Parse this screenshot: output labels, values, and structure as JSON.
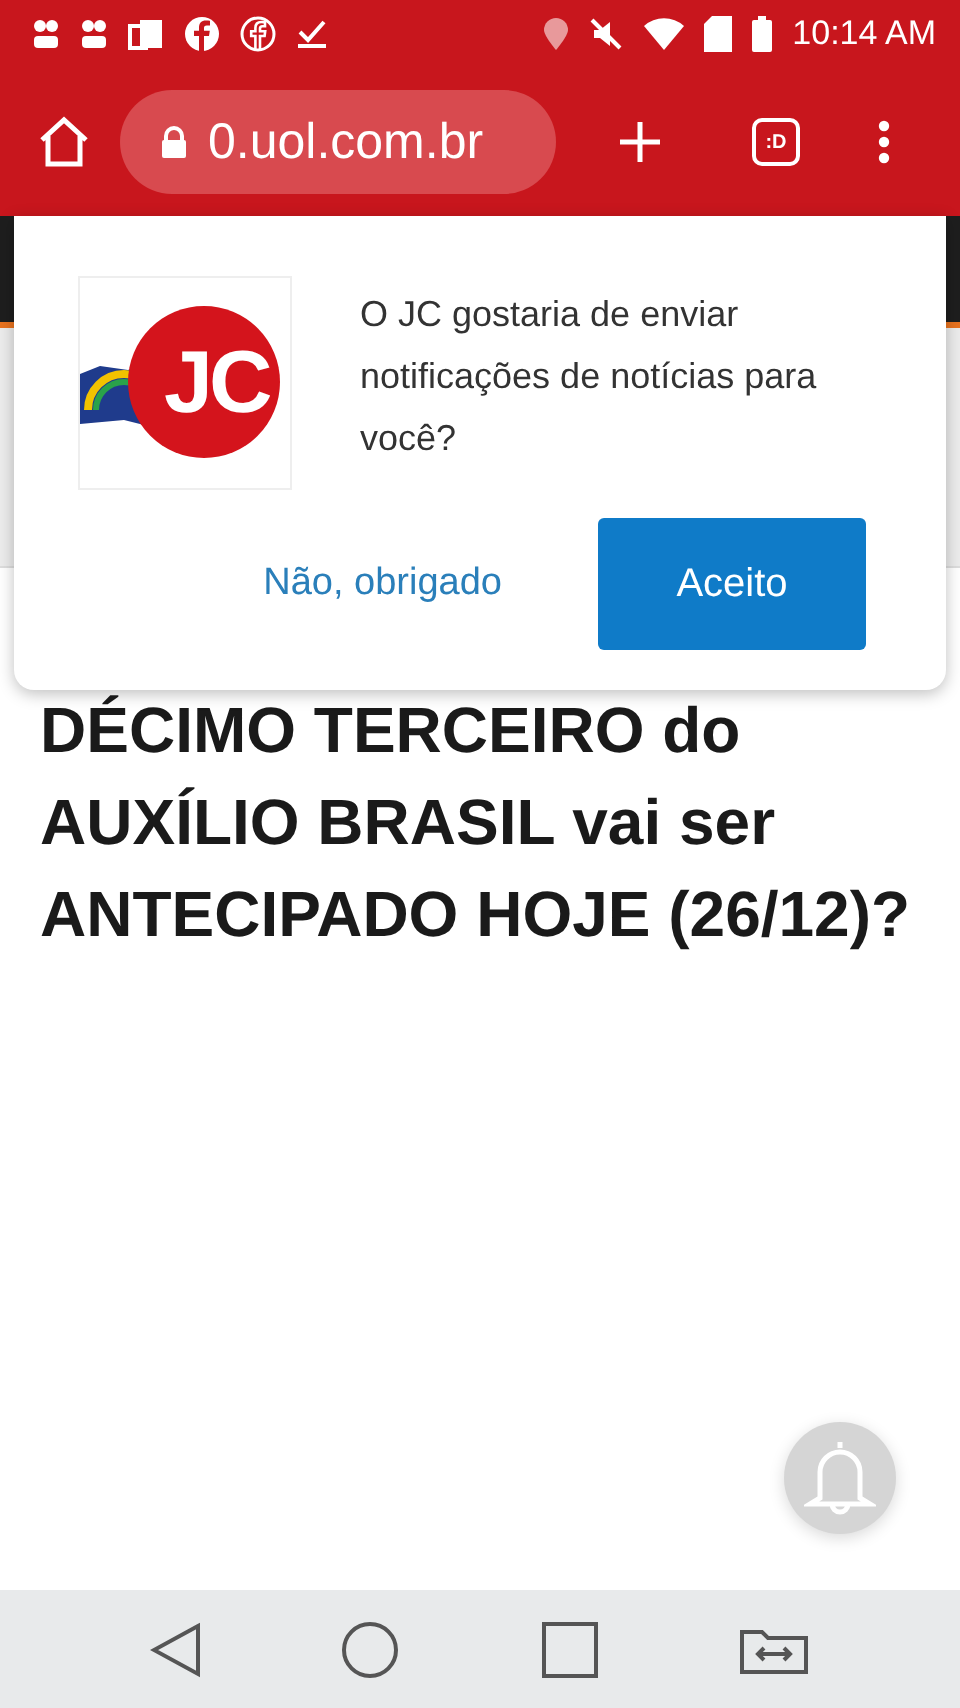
{
  "status_bar": {
    "time": "10:14 AM"
  },
  "toolbar": {
    "url": "0.uol.com.br",
    "tab_count": ":D"
  },
  "dialog": {
    "message": "O JC gostaria de enviar notificações de notícias para você?",
    "logo_text": "JC",
    "decline": "Não, obrigado",
    "accept": "Aceito"
  },
  "article": {
    "headline": "DÉCIMO TERCEIRO do AUXÍLIO BRASIL vai ser ANTECIPADO HOJE (26/12)?"
  }
}
